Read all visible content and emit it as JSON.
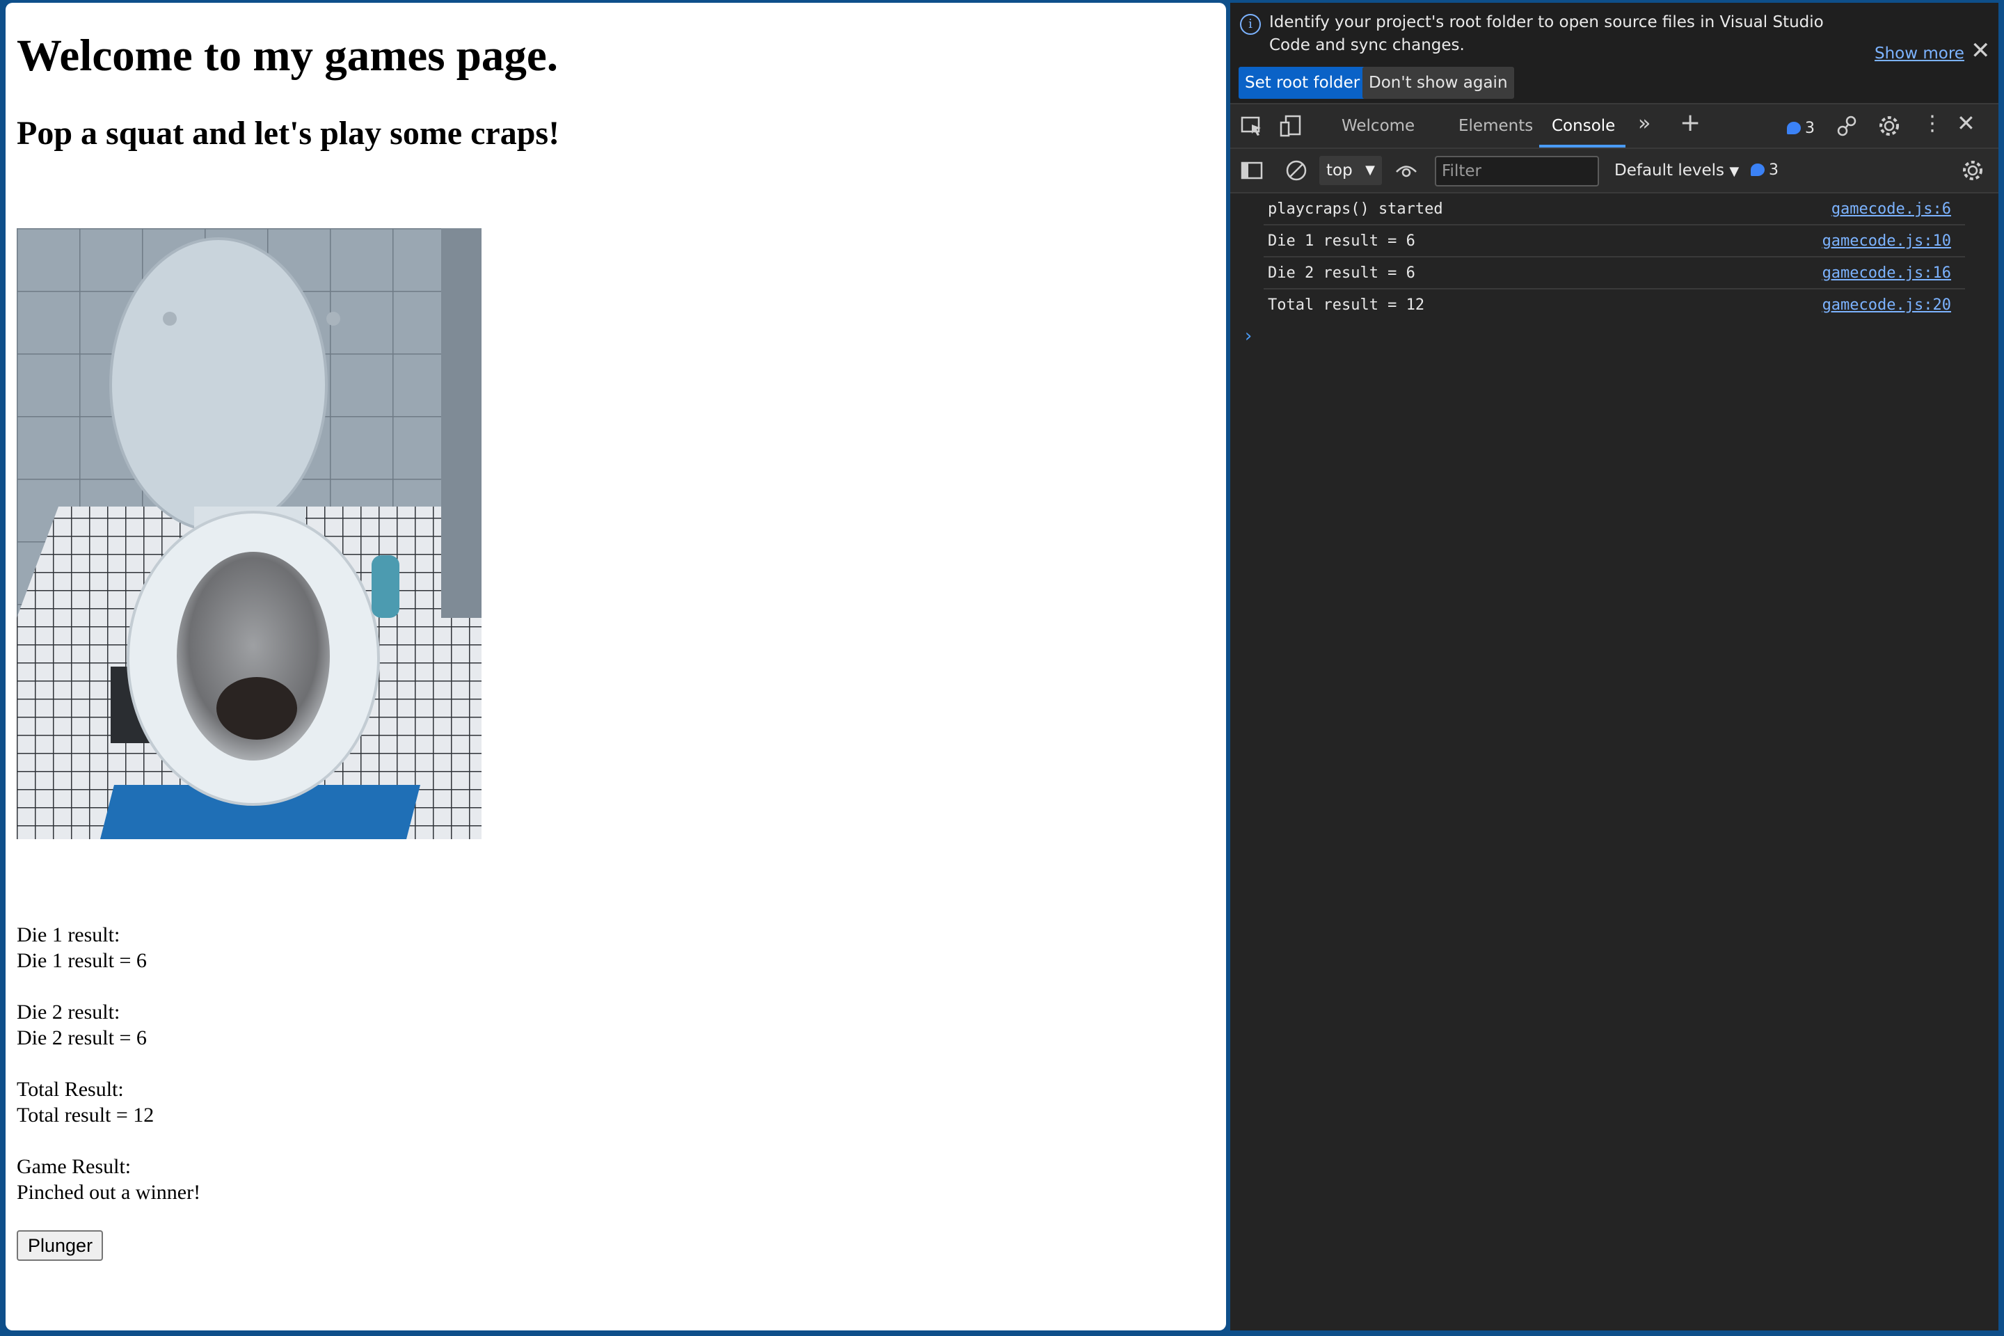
{
  "page": {
    "heading": "Welcome to my games page.",
    "subheading": "Pop a squat and let's play some craps!",
    "image": {
      "subject": "toilet photo"
    },
    "results": [
      "Die 1 result:",
      "Die 1 result = 6",
      "Die 2 result:",
      "Die 2 result = 6",
      "Total Result:",
      "Total result = 12",
      "Game Result:",
      "Pinched out a winner!"
    ],
    "button_label": "Plunger"
  },
  "devtools": {
    "infobar": {
      "message": "Identify your project's root folder to open source files in Visual Studio Code and sync changes.",
      "show_more": "Show more",
      "set_root_label": "Set root folder",
      "dont_show_label": "Don't show again"
    },
    "tabs": [
      "Welcome",
      "Elements",
      "Console"
    ],
    "active_tab": "Console",
    "issues_count": "3",
    "toolbar": {
      "context": "top",
      "filter_placeholder": "Filter",
      "levels": "Default levels",
      "message_count": "3"
    },
    "console": [
      {
        "message": "playcraps() started",
        "source": "gamecode.js:6"
      },
      {
        "message": "Die 1 result = 6",
        "source": "gamecode.js:10"
      },
      {
        "message": "Die 2 result = 6",
        "source": "gamecode.js:16"
      },
      {
        "message": "Total result = 12",
        "source": "gamecode.js:20"
      }
    ],
    "prompt_symbol": "›",
    "colors": {
      "accent": "#0a62c7",
      "link": "#7cb3ff",
      "panel": "#242424"
    }
  }
}
